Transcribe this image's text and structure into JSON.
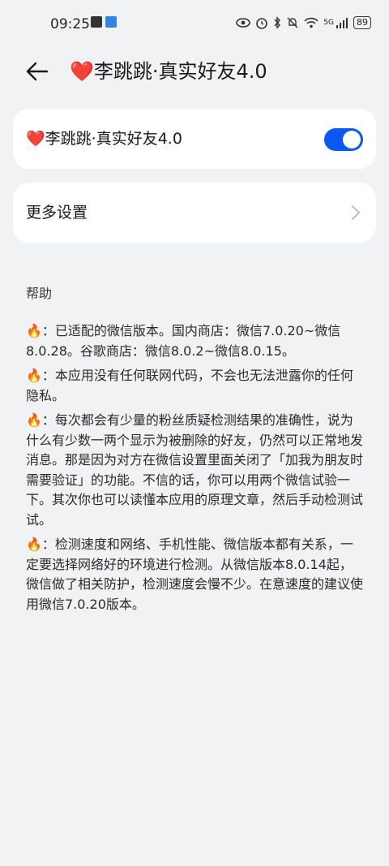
{
  "status_bar": {
    "time": "09:25",
    "network": "5G",
    "battery": "89",
    "icons": [
      "eye-icon",
      "alarm-icon",
      "bluetooth-icon",
      "mute-icon",
      "wifi-icon",
      "signal-icon"
    ]
  },
  "app_bar": {
    "heart": "❤️",
    "title": "李跳跳·真实好友4.0"
  },
  "toggle_card": {
    "heart": "❤️",
    "label": "李跳跳·真实好友4.0",
    "enabled": true,
    "accent_color": "#0a59f7"
  },
  "more_settings": {
    "label": "更多设置"
  },
  "help": {
    "heading": "帮助",
    "fire": "🔥",
    "items": [
      "：已适配的微信版本。国内商店：微信7.0.20~微信8.0.28。谷歌商店：微信8.0.2~微信8.0.15。",
      "：本应用没有任何联网代码，不会也无法泄露你的任何隐私。",
      "：每次都会有少量的粉丝质疑检测结果的准确性，说为什么有少数一两个显示为被删除的好友，仍然可以正常地发消息。那是因为对方在微信设置里面关闭了「加我为朋友时需要验证」的功能。不信的话，你可以用两个微信试验一下。其次你也可以读懂本应用的原理文章，然后手动检测试试。",
      "：检测速度和网络、手机性能、微信版本都有关系，一定要选择网络好的环境进行检测。从微信版本8.0.14起，微信做了相关防护，检测速度会慢不少。在意速度的建议使用微信7.0.20版本。"
    ]
  }
}
